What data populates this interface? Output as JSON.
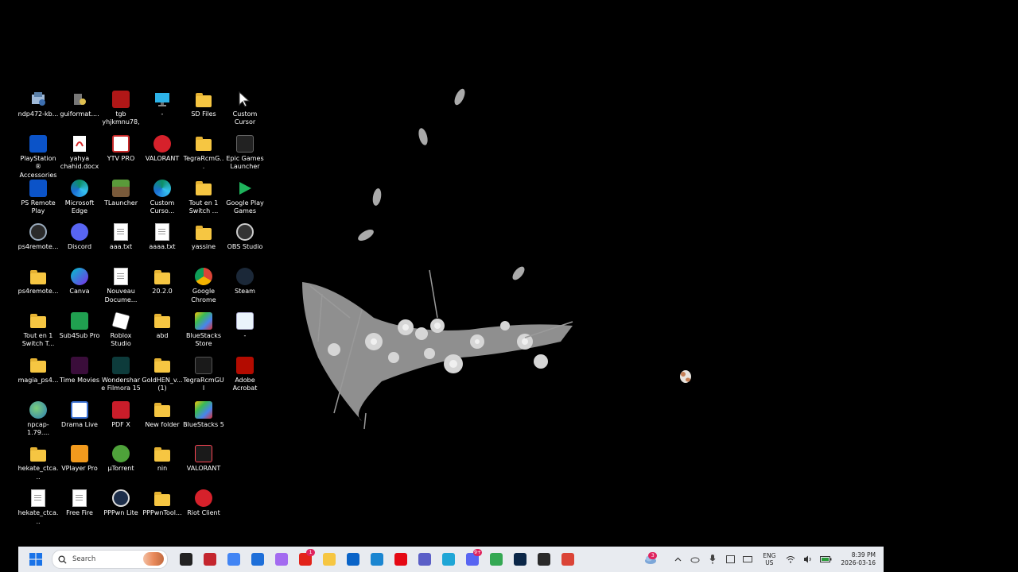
{
  "desktop": {
    "icons": [
      {
        "label": "ndp472-kb...",
        "type": "installer"
      },
      {
        "label": "guiformat....",
        "type": "app"
      },
      {
        "label": "tgb yhjkmnu78,",
        "type": "image"
      },
      {
        "label": "-",
        "type": "monitor"
      },
      {
        "label": "SD Files",
        "type": "folder"
      },
      {
        "label": "Custom Cursor",
        "type": "cursor"
      },
      {
        "label": "PlayStation® Accessories",
        "type": "playstation"
      },
      {
        "label": "yahya chahid.docx",
        "type": "pdf"
      },
      {
        "label": "YTV PRO",
        "type": "ytv"
      },
      {
        "label": "VALORANT",
        "type": "riot"
      },
      {
        "label": "TegraRcmG...",
        "type": "folder"
      },
      {
        "label": "Epic Games Launcher",
        "type": "epic"
      },
      {
        "label": "PS Remote Play",
        "type": "playstation"
      },
      {
        "label": "Microsoft Edge",
        "type": "edge"
      },
      {
        "label": "TLauncher",
        "type": "minecraft"
      },
      {
        "label": "Custom Curso...",
        "type": "edge"
      },
      {
        "label": "Tout en 1 Switch ...",
        "type": "folder"
      },
      {
        "label": "Google Play Games",
        "type": "playgames"
      },
      {
        "label": "ps4remote...",
        "type": "gear"
      },
      {
        "label": "Discord",
        "type": "discord"
      },
      {
        "label": "aaa.txt",
        "type": "doc"
      },
      {
        "label": "aaaa.txt",
        "type": "doc"
      },
      {
        "label": "yassine",
        "type": "folder"
      },
      {
        "label": "OBS Studio",
        "type": "obs"
      },
      {
        "label": "ps4remote...",
        "type": "folder"
      },
      {
        "label": "Canva",
        "type": "canva"
      },
      {
        "label": "Nouveau Docume...",
        "type": "doc"
      },
      {
        "label": "20.2.0",
        "type": "folder"
      },
      {
        "label": "Google Chrome",
        "type": "chrome"
      },
      {
        "label": "Steam",
        "type": "steam"
      },
      {
        "label": "Tout en 1 Switch T...",
        "type": "folder"
      },
      {
        "label": "Sub4Sub Pro",
        "type": "sub4sub"
      },
      {
        "label": "Roblox Studio",
        "type": "roblox"
      },
      {
        "label": "abd",
        "type": "folder"
      },
      {
        "label": "BlueStacks Store",
        "type": "bluestacks"
      },
      {
        "label": "-",
        "type": "recycle"
      },
      {
        "label": "magia_ps4...",
        "type": "folder"
      },
      {
        "label": "Time Movies",
        "type": "timemovies"
      },
      {
        "label": "Wondershare Filmora 15",
        "type": "filmora"
      },
      {
        "label": "GoldHEN_v... (1)",
        "type": "folder"
      },
      {
        "label": "TegraRcmGUI",
        "type": "switch"
      },
      {
        "label": "Adobe Acrobat",
        "type": "acrobat"
      },
      {
        "label": "npcap-1.79....",
        "type": "globe"
      },
      {
        "label": "Drama Live",
        "type": "drama"
      },
      {
        "label": "PDF X",
        "type": "pdfx"
      },
      {
        "label": "New folder",
        "type": "folder"
      },
      {
        "label": "BlueStacks 5",
        "type": "bluestacks"
      },
      {
        "label": "",
        "type": "empty"
      },
      {
        "label": "hekate_ctca...",
        "type": "folder"
      },
      {
        "label": "VPlayer Pro",
        "type": "vplayer"
      },
      {
        "label": "µTorrent",
        "type": "utorrent"
      },
      {
        "label": "nin",
        "type": "folder"
      },
      {
        "label": "VALORANT",
        "type": "valorant"
      },
      {
        "label": "",
        "type": "empty"
      },
      {
        "label": "hekate_ctca...",
        "type": "doc"
      },
      {
        "label": "Free Fire",
        "type": "doc"
      },
      {
        "label": "PPPwn Lite",
        "type": "headset"
      },
      {
        "label": "PPPwnTool...",
        "type": "folder"
      },
      {
        "label": "Riot Client",
        "type": "riot"
      },
      {
        "label": "",
        "type": "empty"
      }
    ]
  },
  "taskbar": {
    "search_placeholder": "Search",
    "apps": [
      {
        "name": "task-view",
        "color": "#222222"
      },
      {
        "name": "pdf-app",
        "color": "#c4262e"
      },
      {
        "name": "chrome",
        "color": "#4285f4"
      },
      {
        "name": "store",
        "color": "#1e6fd9"
      },
      {
        "name": "copilot",
        "color": "#a36bf0"
      },
      {
        "name": "lenovo-app",
        "color": "#e2231a",
        "badge": "1"
      },
      {
        "name": "file-explorer",
        "color": "#f6c642"
      },
      {
        "name": "outlook",
        "color": "#0a64c8"
      },
      {
        "name": "remote-desktop",
        "color": "#1b86d1"
      },
      {
        "name": "netflix",
        "color": "#e50914"
      },
      {
        "name": "teams",
        "color": "#5b5fc7"
      },
      {
        "name": "edge",
        "color": "#1fa6d6"
      },
      {
        "name": "discord",
        "color": "#5865f2",
        "badge": "9+"
      },
      {
        "name": "chrome-profile",
        "color": "#34a853"
      },
      {
        "name": "photoshop",
        "color": "#0b2748"
      },
      {
        "name": "obs",
        "color": "#2a2a2a"
      },
      {
        "name": "chrome-m",
        "color": "#db4437"
      }
    ],
    "tray": {
      "weather_badge": "3",
      "language": "ENG",
      "region": "US",
      "time": "8:39 PM",
      "date": "2026-03-16"
    }
  },
  "colors": {
    "desktop_bg": "#000000",
    "taskbar_bg": "#e8ebf0"
  }
}
